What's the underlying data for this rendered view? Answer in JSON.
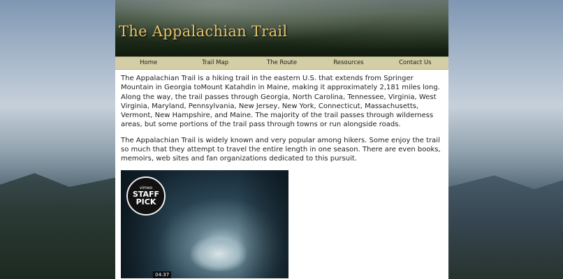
{
  "header": {
    "site_title": "The Appalachian Trail"
  },
  "nav": {
    "items": [
      {
        "label": "Home"
      },
      {
        "label": "Trail Map"
      },
      {
        "label": "The Route"
      },
      {
        "label": "Resources"
      },
      {
        "label": "Contact Us"
      }
    ]
  },
  "content": {
    "paragraph1": "The Appalachian Trail is a hiking trail in the eastern U.S. that extends from Springer Mountain in Georgia toMount Katahdin in Maine, making it approximately 2,181 miles long. Along the way, the trail passes through Georgia, North Carolina, Tennessee, Virginia, West Virginia, Maryland, Pennsylvania, New Jersey, New York, Connecticut, Massachusetts, Vermont, New Hampshire, and Maine. The majority of the trail passes through wilderness areas, but some portions of the trail pass through towns or run alongside roads.",
    "paragraph2": "The Appalachian Trail is widely known and very popular among hikers. Some enjoy the trail so much that they attempt to travel the entire length in one season. There are even books, memoirs, web sites and fan organizations dedicated to this pursuit."
  },
  "video": {
    "badge_top": "vimeo",
    "badge_line1": "STAFF",
    "badge_line2": "PICK",
    "duration": "04:37"
  }
}
